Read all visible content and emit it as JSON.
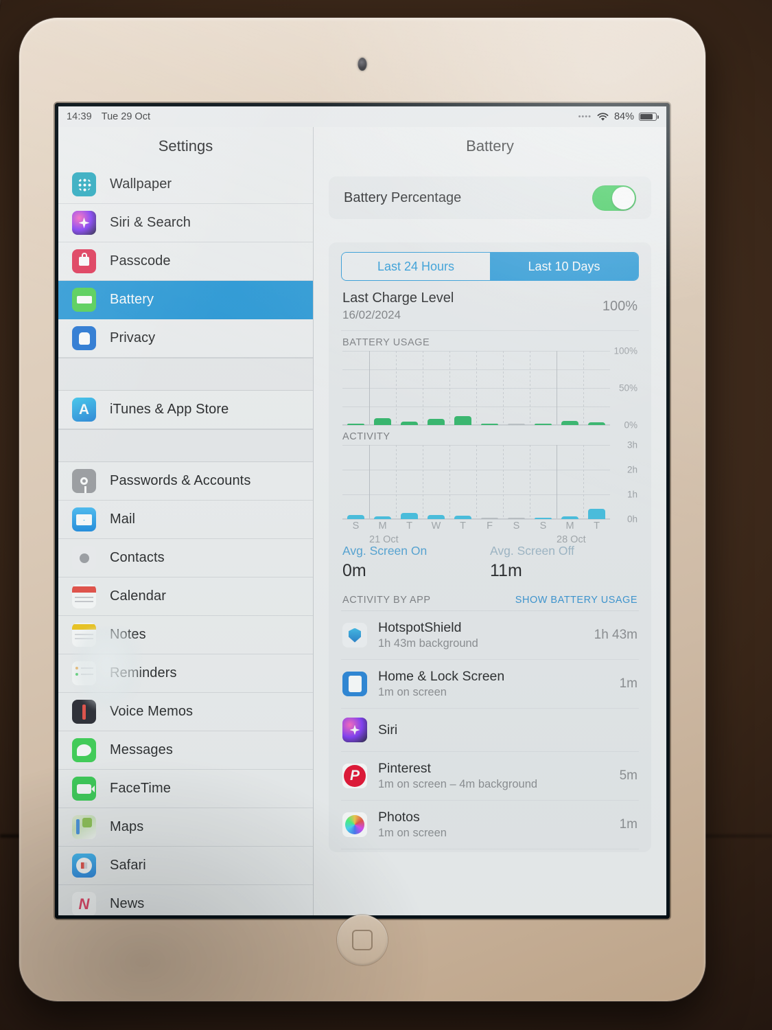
{
  "status_bar": {
    "time": "14:39",
    "date": "Tue 29 Oct",
    "signal_dots": "••••",
    "wifi_icon": "wifi-icon",
    "battery_percent": "84%",
    "battery_icon": "battery-icon"
  },
  "sidebar": {
    "title": "Settings",
    "items": [
      {
        "label": "Wallpaper",
        "icon": "wallpaper-icon",
        "glyph": "✳",
        "cls": "ic-wallpaper",
        "selected": false
      },
      {
        "label": "Siri & Search",
        "icon": "siri-icon",
        "glyph": "✦",
        "cls": "ic-siri",
        "selected": false
      },
      {
        "label": "Passcode",
        "icon": "lock-icon",
        "glyph": "🔒",
        "cls": "ic-passcode",
        "selected": false
      },
      {
        "label": "Battery",
        "icon": "battery-icon",
        "glyph": "▭",
        "cls": "ic-battery",
        "selected": true
      },
      {
        "label": "Privacy",
        "icon": "hand-icon",
        "glyph": "✋",
        "cls": "ic-privacy",
        "selected": false
      },
      {
        "label": "iTunes & App Store",
        "icon": "app-store-icon",
        "glyph": "A",
        "cls": "ic-appstore",
        "selected": false
      },
      {
        "label": "Passwords & Accounts",
        "icon": "key-icon",
        "glyph": "🔑",
        "cls": "ic-keys",
        "selected": false
      },
      {
        "label": "Mail",
        "icon": "mail-icon",
        "glyph": "✉",
        "cls": "ic-mail",
        "selected": false
      },
      {
        "label": "Contacts",
        "icon": "contacts-icon",
        "glyph": "👤",
        "cls": "ic-contacts",
        "selected": false
      },
      {
        "label": "Calendar",
        "icon": "calendar-icon",
        "glyph": "",
        "cls": "ic-calendar",
        "selected": false
      },
      {
        "label": "Notes",
        "icon": "notes-icon",
        "glyph": "",
        "cls": "ic-notes",
        "selected": false
      },
      {
        "label": "Reminders",
        "icon": "reminders-icon",
        "glyph": "",
        "cls": "ic-reminders",
        "selected": false
      },
      {
        "label": "Voice Memos",
        "icon": "voice-memos-icon",
        "glyph": "",
        "cls": "ic-voice",
        "selected": false
      },
      {
        "label": "Messages",
        "icon": "messages-icon",
        "glyph": "💬",
        "cls": "ic-messages",
        "selected": false
      },
      {
        "label": "FaceTime",
        "icon": "facetime-icon",
        "glyph": "📹",
        "cls": "ic-facetime",
        "selected": false
      },
      {
        "label": "Maps",
        "icon": "maps-icon",
        "glyph": "",
        "cls": "ic-maps",
        "selected": false
      },
      {
        "label": "Safari",
        "icon": "safari-icon",
        "glyph": "✜",
        "cls": "ic-safari",
        "selected": false
      },
      {
        "label": "News",
        "icon": "news-icon",
        "glyph": "N",
        "cls": "ic-news",
        "selected": false
      }
    ],
    "group_breaks_after": [
      4,
      5
    ]
  },
  "detail": {
    "title": "Battery",
    "battery_percentage": {
      "label": "Battery Percentage",
      "enabled": true
    },
    "segmented": {
      "options": [
        "Last 24 Hours",
        "Last 10 Days"
      ],
      "selected_index": 1
    },
    "last_charge": {
      "label": "Last Charge Level",
      "date": "16/02/2024",
      "value": "100%"
    },
    "avg_screen_on": {
      "label": "Avg. Screen On",
      "value": "0m"
    },
    "avg_screen_off": {
      "label": "Avg. Screen Off",
      "value": "11m"
    },
    "activity_by_app_caption": "ACTIVITY BY APP",
    "show_battery_usage_link": "SHOW BATTERY USAGE",
    "apps": [
      {
        "name": "HotspotShield",
        "detail": "1h 43m background",
        "time": "1h 43m",
        "icon": "hotspotshield-icon",
        "cls": "ic-hss"
      },
      {
        "name": "Home & Lock Screen",
        "detail": "1m on screen",
        "time": "1m",
        "icon": "home-lock-screen-icon",
        "cls": "ic-hls"
      },
      {
        "name": "Siri",
        "detail": "",
        "time": "",
        "icon": "siri-icon",
        "cls": "ic-siri"
      },
      {
        "name": "Pinterest",
        "detail": "1m on screen – 4m background",
        "time": "5m",
        "icon": "pinterest-icon",
        "cls": "ic-pin"
      },
      {
        "name": "Photos",
        "detail": "1m on screen",
        "time": "1m",
        "icon": "photos-icon",
        "cls": "ic-photos"
      }
    ]
  },
  "chart_data": [
    {
      "type": "bar",
      "title": "BATTERY USAGE",
      "categories": [
        "S",
        "M",
        "T",
        "W",
        "T",
        "F",
        "S",
        "S",
        "M",
        "T"
      ],
      "values": [
        0.5,
        9,
        4.5,
        8,
        12,
        1,
        0,
        1,
        6,
        4
      ],
      "xlabel": "",
      "ylabel": "Battery usage",
      "ylim": [
        0,
        100
      ],
      "ytick_labels": [
        "0%",
        "50%",
        "100%"
      ],
      "yticks": [
        0,
        50,
        100
      ],
      "grid": true,
      "bar_color": "#28b463",
      "x_markers": [
        "21 Oct",
        "28 Oct"
      ]
    },
    {
      "type": "bar",
      "title": "ACTIVITY",
      "categories": [
        "S",
        "M",
        "T",
        "W",
        "T",
        "F",
        "S",
        "S",
        "M",
        "T"
      ],
      "values": [
        0.18,
        0.12,
        0.25,
        0.17,
        0.15,
        0.01,
        0.0,
        0.04,
        0.1,
        0.42
      ],
      "xlabel": "",
      "ylabel": "Activity",
      "ylim": [
        0,
        3
      ],
      "ytick_labels": [
        "0h",
        "1h",
        "2h",
        "3h"
      ],
      "yticks": [
        0,
        1,
        2,
        3
      ],
      "grid": true,
      "bar_color": "#3cbde0",
      "x_markers": [
        "21 Oct",
        "28 Oct"
      ]
    }
  ]
}
